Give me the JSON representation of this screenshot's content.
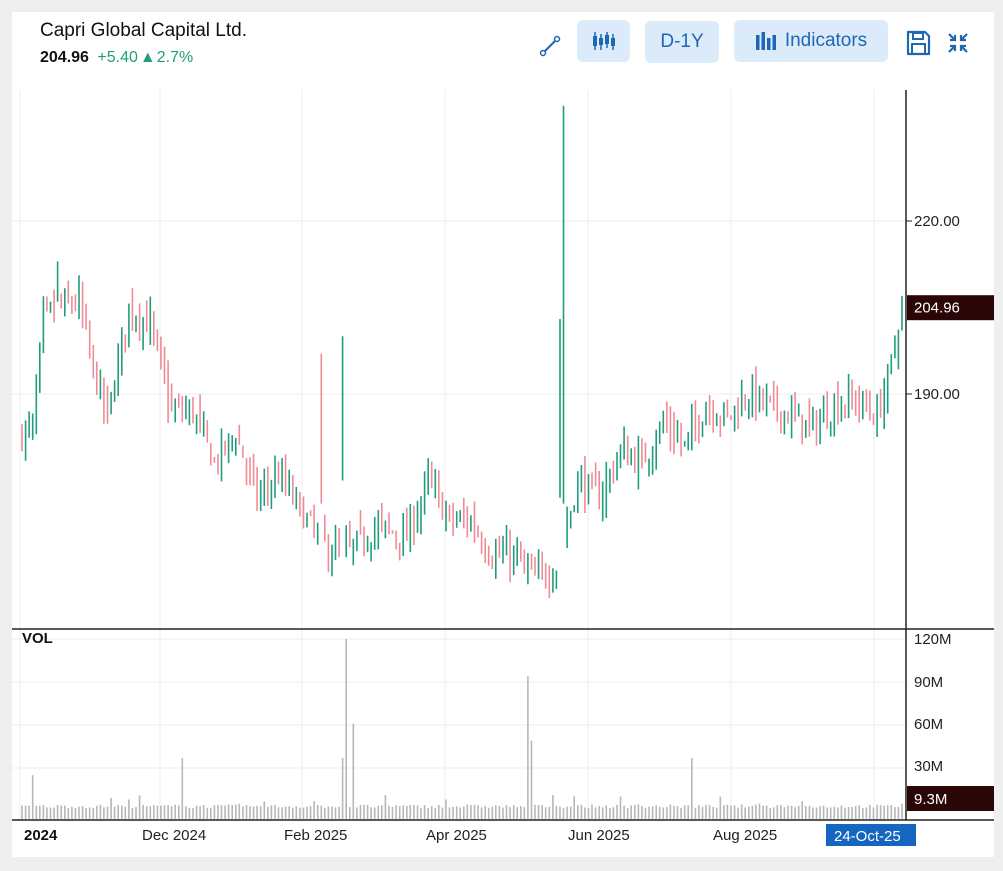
{
  "header": {
    "title": "Capri Global Capital Ltd.",
    "price": "204.96",
    "change": "+5.40",
    "change_arrow": "▲",
    "change_pct": "2.7%",
    "up_color": "#1e9e7d",
    "down_color": "#f08a95"
  },
  "toolbar": {
    "draw_icon": "line-draw-icon",
    "candle_icon": "candlestick-icon",
    "period_label": "D-1Y",
    "indicators_icon": "bar-chart-icon",
    "indicators_label": "Indicators",
    "save_icon": "save-icon",
    "collapse_icon": "collapse-icon"
  },
  "chart_data": [
    {
      "type": "bar",
      "series_style": "ohlc",
      "x_ticks": [
        "2024",
        "Dec 2024",
        "Feb 2025",
        "Apr 2025",
        "Jun 2025",
        "Aug 2025"
      ],
      "x_current_label": "24-Oct-25",
      "y_ticks": [
        "220.00",
        "190.00"
      ],
      "y_tick_values": [
        220,
        190
      ],
      "last_price_label": "204.96",
      "last_price": 204.96,
      "ylim": [
        152,
        250
      ],
      "grid": true
    },
    {
      "type": "bar",
      "title": "VOL",
      "y_ticks": [
        "120M",
        "90M",
        "60M",
        "30M"
      ],
      "y_tick_values": [
        120,
        90,
        60,
        30
      ],
      "last_volume_label": "9.3M",
      "ylim": [
        0,
        120
      ],
      "units": "M",
      "spikes": [
        {
          "date": "2024-10-28",
          "value": 25
        },
        {
          "date": "2024-12-30",
          "value": 37
        },
        {
          "date": "2025-03-06",
          "value": 37
        },
        {
          "date": "2025-03-07",
          "value": 120
        },
        {
          "date": "2025-03-10",
          "value": 61
        },
        {
          "date": "2025-05-22",
          "value": 94
        },
        {
          "date": "2025-05-23",
          "value": 49
        },
        {
          "date": "2025-07-29",
          "value": 37
        }
      ]
    }
  ]
}
